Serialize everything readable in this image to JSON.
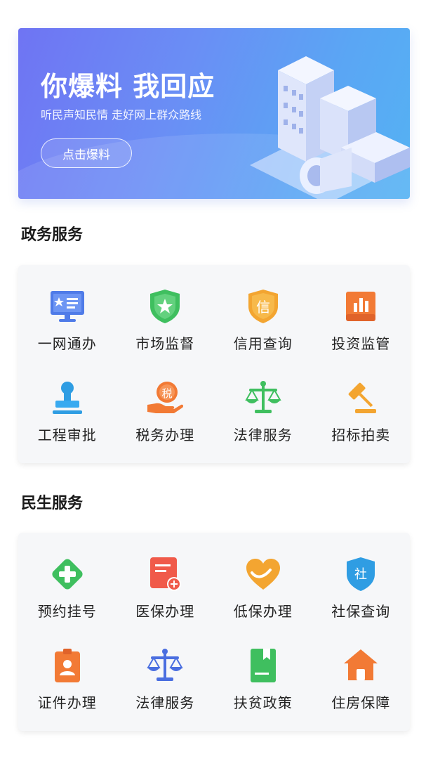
{
  "banner": {
    "title": "你爆料 我回应",
    "subtitle": "听民声知民情 走好网上群众路线",
    "button": "点击爆料"
  },
  "gov": {
    "title": "政务服务",
    "items": [
      {
        "label": "一网通办",
        "icon": "monitor-card-icon"
      },
      {
        "label": "市场监督",
        "icon": "shield-star-icon"
      },
      {
        "label": "信用查询",
        "icon": "credit-badge-icon"
      },
      {
        "label": "投资监管",
        "icon": "bar-chart-icon"
      },
      {
        "label": "工程审批",
        "icon": "stamp-icon"
      },
      {
        "label": "税务办理",
        "icon": "tax-hand-icon"
      },
      {
        "label": "法律服务",
        "icon": "scales-icon"
      },
      {
        "label": "招标拍卖",
        "icon": "gavel-icon"
      }
    ]
  },
  "life": {
    "title": "民生服务",
    "items": [
      {
        "label": "预约挂号",
        "icon": "medical-cross-icon"
      },
      {
        "label": "医保办理",
        "icon": "medical-form-icon"
      },
      {
        "label": "低保办理",
        "icon": "heart-icon"
      },
      {
        "label": "社保查询",
        "icon": "social-shield-icon"
      },
      {
        "label": "证件办理",
        "icon": "id-card-icon"
      },
      {
        "label": "法律服务",
        "icon": "scales-icon"
      },
      {
        "label": "扶贫政策",
        "icon": "book-icon"
      },
      {
        "label": "住房保障",
        "icon": "house-icon"
      }
    ]
  },
  "icon_glyphs": {
    "credit": "信",
    "tax": "税",
    "social": "社"
  },
  "colors": {
    "green": "#3fbf5f",
    "orange": "#f3a531",
    "blue": "#4a7ee6",
    "red": "#f05a4a"
  }
}
